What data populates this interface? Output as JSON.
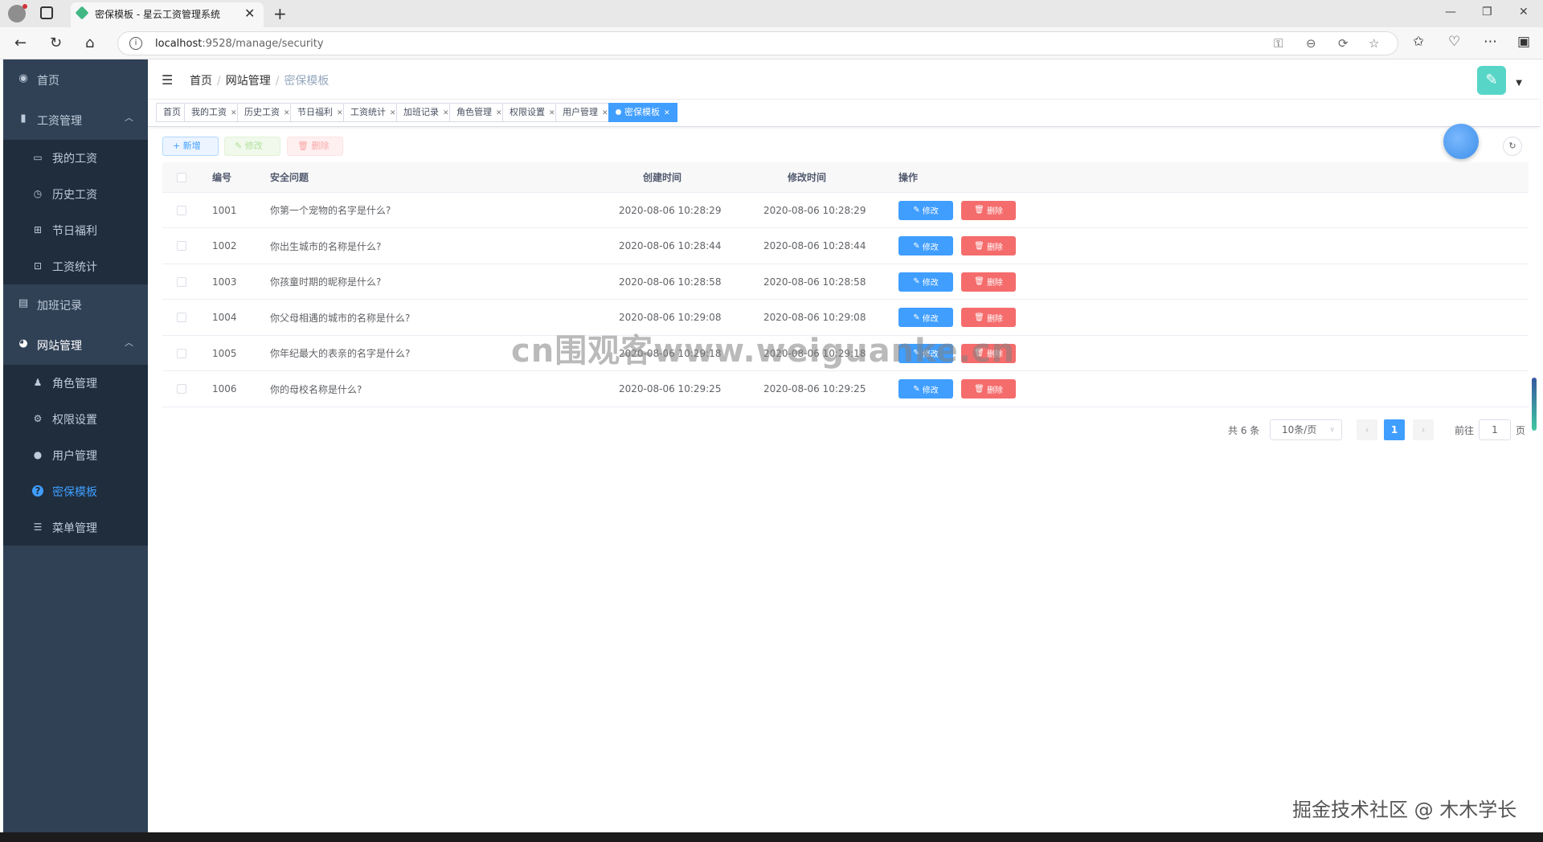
{
  "browser": {
    "tab_title": "密保模板 - 星云工资管理系统",
    "url_host": "localhost",
    "url_rest": ":9528/manage/security"
  },
  "sidebar": {
    "items": [
      {
        "label": "首页",
        "icon": "dashboard-icon"
      },
      {
        "label": "工资管理",
        "icon": "chart-icon"
      },
      {
        "label": "加班记录",
        "icon": "calendar-icon"
      },
      {
        "label": "网站管理",
        "icon": "globe-icon"
      }
    ],
    "salary_sub": [
      {
        "label": "我的工资",
        "icon": "wallet-icon"
      },
      {
        "label": "历史工资",
        "icon": "clock-icon"
      },
      {
        "label": "节日福利",
        "icon": "gift-icon"
      },
      {
        "label": "工资统计",
        "icon": "stats-icon"
      }
    ],
    "site_sub": [
      {
        "label": "角色管理",
        "icon": "role-icon"
      },
      {
        "label": "权限设置",
        "icon": "gear-icon"
      },
      {
        "label": "用户管理",
        "icon": "user-icon"
      },
      {
        "label": "密保模板",
        "icon": "question-icon"
      },
      {
        "label": "菜单管理",
        "icon": "menu-list-icon"
      }
    ]
  },
  "breadcrumb": [
    "首页",
    "网站管理",
    "密保模板"
  ],
  "tags": [
    "首页",
    "我的工资",
    "历史工资",
    "节日福利",
    "工资统计",
    "加班记录",
    "角色管理",
    "权限设置",
    "用户管理",
    "密保模板"
  ],
  "toolbar": {
    "add": "+ 新增",
    "edit": "修改",
    "delete": "删除"
  },
  "table": {
    "headers": {
      "id": "编号",
      "question": "安全问题",
      "created": "创建时间",
      "modified": "修改时间",
      "actions": "操作"
    },
    "rows": [
      {
        "id": "1001",
        "question": "你第一个宠物的名字是什么?",
        "created": "2020-08-06 10:28:29",
        "modified": "2020-08-06 10:28:29"
      },
      {
        "id": "1002",
        "question": "你出生城市的名称是什么?",
        "created": "2020-08-06 10:28:44",
        "modified": "2020-08-06 10:28:44"
      },
      {
        "id": "1003",
        "question": "你孩童时期的昵称是什么?",
        "created": "2020-08-06 10:28:58",
        "modified": "2020-08-06 10:28:58"
      },
      {
        "id": "1004",
        "question": "你父母相遇的城市的名称是什么?",
        "created": "2020-08-06 10:29:08",
        "modified": "2020-08-06 10:29:08"
      },
      {
        "id": "1005",
        "question": "你年纪最大的表亲的名字是什么?",
        "created": "2020-08-06 10:29:18",
        "modified": "2020-08-06 10:29:18"
      },
      {
        "id": "1006",
        "question": "你的母校名称是什么?",
        "created": "2020-08-06 10:29:25",
        "modified": "2020-08-06 10:29:25"
      }
    ],
    "row_edit": "修改",
    "row_delete": "删除"
  },
  "pagination": {
    "total": "共 6 条",
    "page_size": "10条/页",
    "current": "1",
    "goto": "前往",
    "goto_value": "1",
    "page_unit": "页"
  },
  "watermark": "cn围观客www.weiguanke.cn",
  "credit": "掘金技术社区 @ 木木学长",
  "colors": {
    "sidebar": "#304156",
    "submenu": "#1f2d3d",
    "primary": "#409eff",
    "danger": "#f56c6c",
    "active_menu": "#409eff"
  }
}
